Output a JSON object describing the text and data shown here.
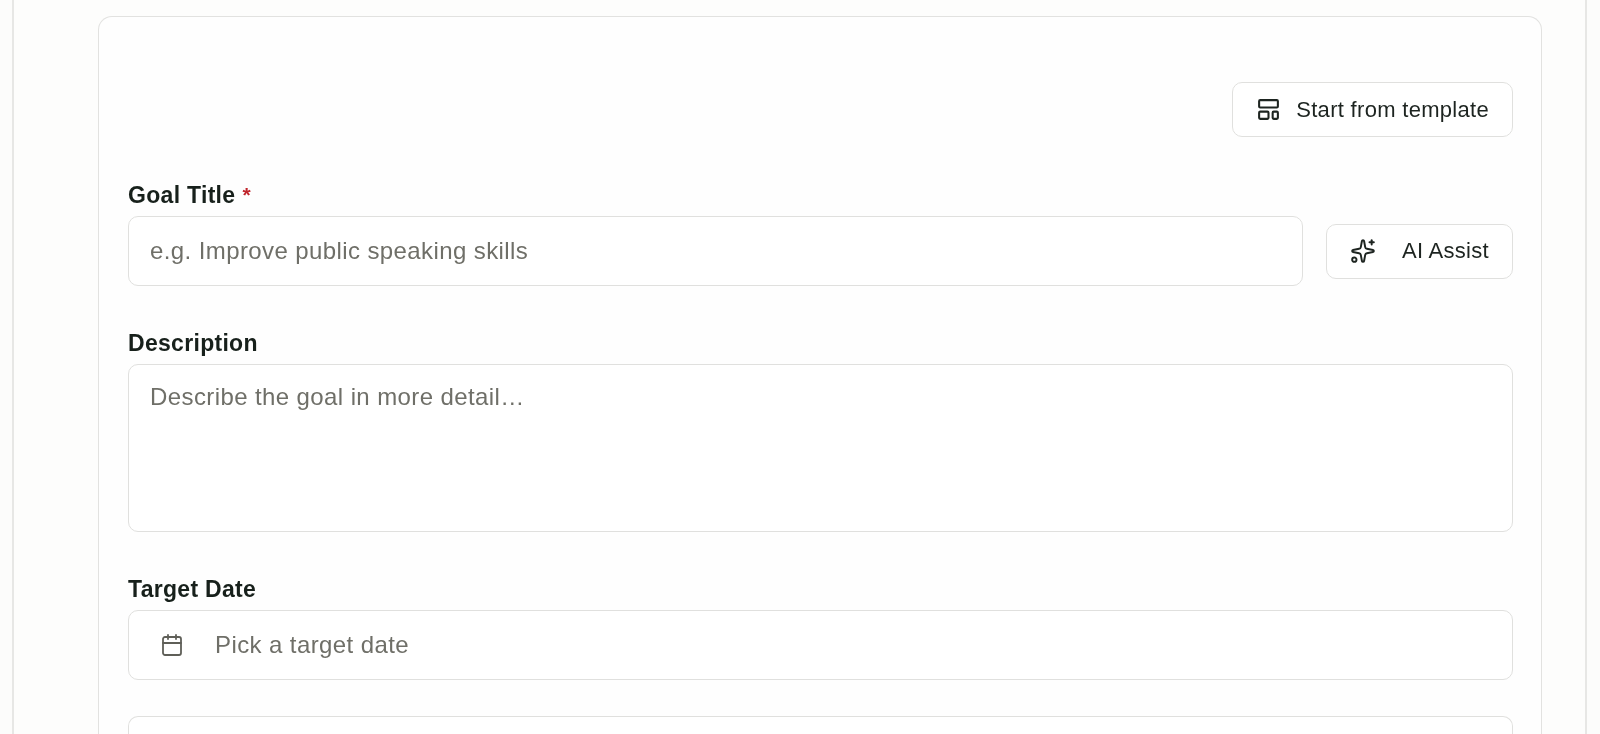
{
  "template_button": {
    "label": "Start from template"
  },
  "fields": [
    {
      "kind": "text",
      "label": "Goal Title",
      "required_mark": "*",
      "placeholder": "e.g. Improve public speaking skills",
      "assist_button": {
        "label": "AI Assist"
      }
    },
    {
      "kind": "textarea",
      "label": "Description",
      "placeholder": "Describe the goal in more detail…"
    },
    {
      "kind": "date",
      "label": "Target Date",
      "placeholder": "Pick a target date"
    },
    {
      "kind": "box"
    }
  ]
}
